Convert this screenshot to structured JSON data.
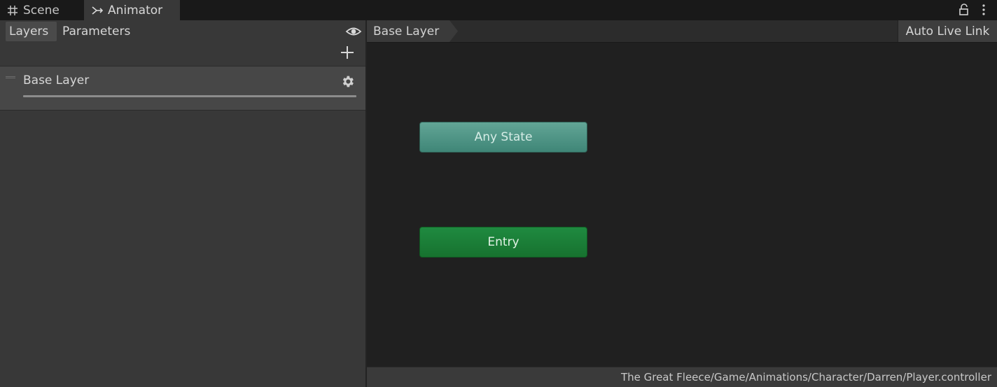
{
  "tabs": [
    {
      "label": "Scene",
      "icon": "grid-icon"
    },
    {
      "label": "Animator",
      "icon": "animator-icon",
      "active": true
    }
  ],
  "left_panel": {
    "tabs": [
      {
        "label": "Layers",
        "active": true
      },
      {
        "label": "Parameters"
      }
    ],
    "layers": [
      {
        "name": "Base Layer"
      }
    ]
  },
  "graph": {
    "breadcrumb": "Base Layer",
    "auto_live_link_label": "Auto Live Link",
    "nodes": {
      "any_state": "Any State",
      "entry": "Entry"
    }
  },
  "status": {
    "path": "The Great Fleece/Game/Animations/Character/Darren/Player.controller"
  },
  "colors": {
    "background": "#202020",
    "panel": "#383838",
    "any_state": "#4f9686",
    "entry": "#1b7e37"
  }
}
